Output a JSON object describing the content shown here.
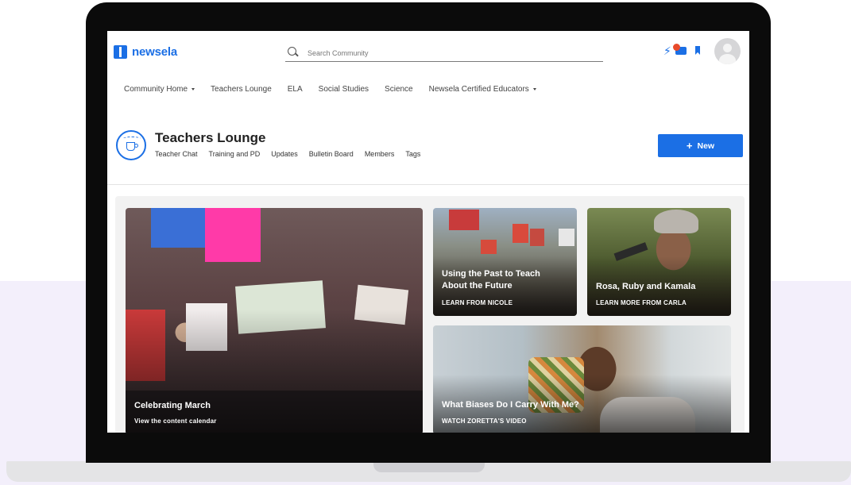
{
  "app": {
    "logo_text": "newsela",
    "brand_color": "#1b6fe5"
  },
  "header": {
    "search": {
      "placeholder": "Search Community",
      "value": ""
    },
    "icons": [
      "lightning-icon",
      "chat-icon",
      "bookmark-icon"
    ],
    "chat_badge_color": "#e84a2a"
  },
  "nav": {
    "items": [
      {
        "label": "Community Home",
        "has_dropdown": true
      },
      {
        "label": "Teachers Lounge",
        "has_dropdown": false
      },
      {
        "label": "ELA",
        "has_dropdown": false
      },
      {
        "label": "Social Studies",
        "has_dropdown": false
      },
      {
        "label": "Science",
        "has_dropdown": false
      },
      {
        "label": "Newsela Certified Educators",
        "has_dropdown": true
      }
    ]
  },
  "group": {
    "title": "Teachers Lounge",
    "subnav": [
      "Teacher Chat",
      "Training and PD",
      "Updates",
      "Bulletin Board",
      "Members",
      "Tags"
    ],
    "new_button_label": "New"
  },
  "cards": [
    {
      "title": "Celebrating March",
      "subtitle": "View the content calendar"
    },
    {
      "title": "Using the Past to Teach\nAbout the Future",
      "subtitle": "LEARN FROM NICOLE"
    },
    {
      "title": "Rosa, Ruby and Kamala",
      "subtitle": "LEARN MORE FROM CARLA"
    },
    {
      "title": "What Biases Do I Carry With Me?",
      "subtitle": "WATCH ZORETTA'S VIDEO"
    }
  ]
}
